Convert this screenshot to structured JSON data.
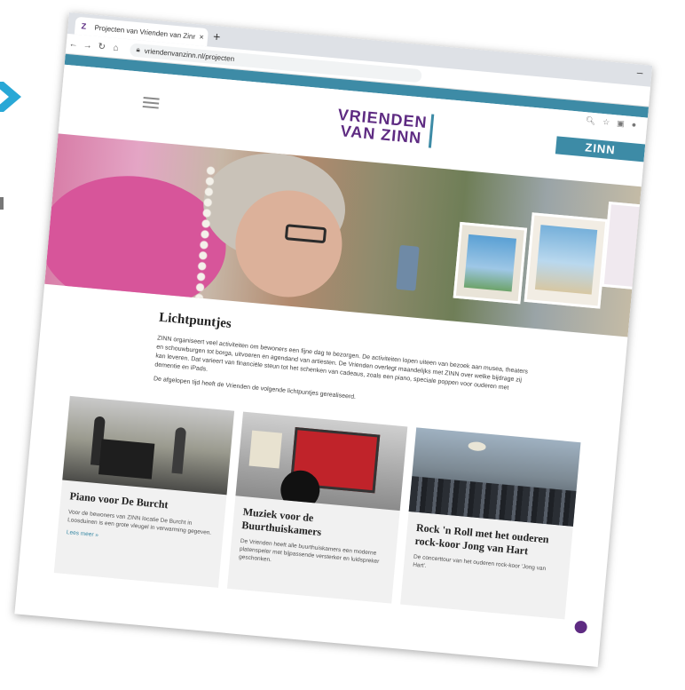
{
  "browser": {
    "tab_title": "Projecten van Vrienden van Zinn",
    "favicon": "Z",
    "tab_close": "×",
    "new_tab": "+",
    "url": "vriendenvanzinn.nl/projecten",
    "window_min": "–"
  },
  "site": {
    "logo_line1": "VRIENDEN",
    "logo_line2": "VAN ZINN",
    "zinn_label": "ZINN",
    "colors": {
      "purple": "#5e2b82",
      "teal": "#3d8ba6"
    }
  },
  "section": {
    "title": "Lichtpuntjes",
    "body": "ZINN organiseert veel activiteiten om bewoners een fijne dag te bezorgen. De activiteiten lopen uiteen van bezoek aan musea, theaters en schouwburgen tot borga, uitvoeren en agendand van artiesten. De Vrienden overlegt maandelijks met ZINN over welke bijdrage zij kan leveren. Dat varieert van financiële steun tot het schenken van cadeaus, zoals een piano, speciale poppen voor ouderen met dementie en iPads.",
    "intro_cards": "De afgelopen tijd heeft de Vrienden de volgende lichtpuntjes gerealiseerd."
  },
  "cards": [
    {
      "title": "Piano voor De Burcht",
      "text": "Voor de bewoners van ZINN locatie De Burcht in Loosduinen is een grote vleugel in verwarming gegeven.",
      "more": "Lees meer »"
    },
    {
      "title": "Muziek voor de Buurthuiskamers",
      "text": "De Vrienden heeft alle buurthuiskamers een moderne platenspeler met bijpassende versterker en luidspreker geschonken.",
      "more": ""
    },
    {
      "title": "Rock 'n Roll met het ouderen rock-koor Jong van Hart",
      "text": "De concerttour van het ouderen rock-koor 'Jong van Hart'.",
      "more": ""
    }
  ]
}
